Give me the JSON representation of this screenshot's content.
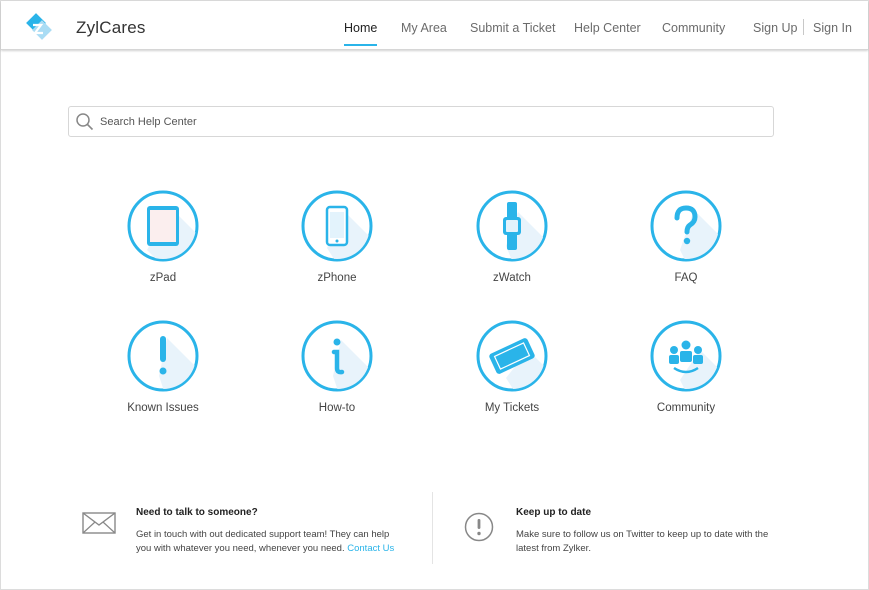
{
  "header": {
    "brand": "ZylCares",
    "nav": [
      "Home",
      "My Area",
      "Submit a Ticket",
      "Help Center",
      "Community"
    ],
    "active_nav": "Home",
    "sign_up": "Sign Up",
    "sign_in": "Sign In"
  },
  "search": {
    "placeholder": "Search Help Center"
  },
  "categories": [
    {
      "label": "zPad",
      "icon": "tablet-icon"
    },
    {
      "label": "zPhone",
      "icon": "phone-icon"
    },
    {
      "label": "zWatch",
      "icon": "watch-icon"
    },
    {
      "label": "FAQ",
      "icon": "question-icon"
    },
    {
      "label": "Known Issues",
      "icon": "exclamation-icon"
    },
    {
      "label": "How-to",
      "icon": "info-icon"
    },
    {
      "label": "My Tickets",
      "icon": "ticket-icon"
    },
    {
      "label": "Community",
      "icon": "people-icon"
    }
  ],
  "footer": {
    "contact": {
      "title": "Need to talk to someone?",
      "text": "Get in touch with out dedicated support team! They can help you with whatever you need, whenever you need.",
      "link": "Contact Us",
      "icon": "envelope-icon"
    },
    "updates": {
      "title": "Keep up to date",
      "text": "Make sure to follow us on Twitter to keep up to date with the latest from Zylker.",
      "icon": "alert-circle-icon"
    }
  },
  "colors": {
    "accent": "#2ab4e9",
    "text": "#333333",
    "icon_shadow": "#e8f3fb"
  }
}
